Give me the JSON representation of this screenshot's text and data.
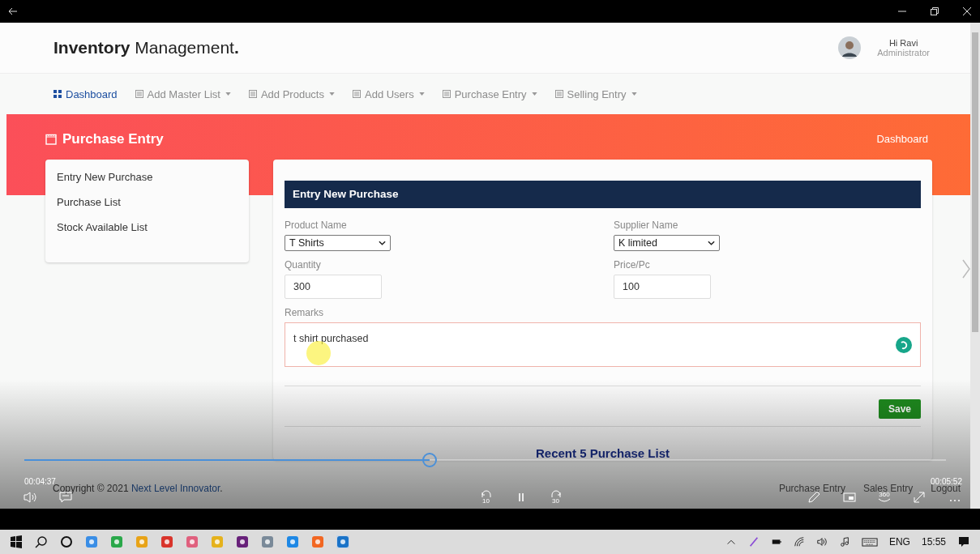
{
  "header": {
    "brand": "**Inventory** Management**.**",
    "user": {
      "greeting": "Hi Ravi",
      "role": "Administrator"
    }
  },
  "nav": [
    {
      "label": "Dashboard",
      "selected": true,
      "dropdown": false
    },
    {
      "label": "Add Master List",
      "selected": false,
      "dropdown": true
    },
    {
      "label": "Add Products",
      "selected": false,
      "dropdown": true
    },
    {
      "label": "Add Users",
      "selected": false,
      "dropdown": true
    },
    {
      "label": "Purchase Entry",
      "selected": false,
      "dropdown": true
    },
    {
      "label": "Selling Entry",
      "selected": false,
      "dropdown": true
    }
  ],
  "banner": {
    "title": "Purchase Entry",
    "link": "Dashboard"
  },
  "sidebar": {
    "items": [
      "Entry New Purchase",
      "Purchase List",
      "Stock Available List"
    ]
  },
  "form": {
    "title": "Entry New Purchase",
    "fields": [
      {
        "kind": "select",
        "label": "Product Name",
        "value": "T Shirts"
      },
      {
        "kind": "select",
        "label": "Supplier Name",
        "value": "K limited"
      },
      {
        "kind": "input",
        "label": "Quantity",
        "value": "300"
      },
      {
        "kind": "input",
        "label": "Price/Pc",
        "value": "100"
      }
    ],
    "remarks": {
      "label": "Remarks",
      "value": "t shirt purchased"
    },
    "save_button": "Save"
  },
  "recent_title": "Recent 5 Purchase List",
  "footer": {
    "copyright_prefix": "Copyright © 2021 ",
    "company": "Next Level Innovator",
    "copyright_suffix": ".",
    "links": [
      "Purchase Entry",
      "Sales Entry",
      "Logout"
    ]
  },
  "player": {
    "elapsed": "00:04:37",
    "duration": "00:05:52",
    "progress": {
      "level": 0.44
    },
    "rewind_label": "10",
    "forward_label": "30",
    "vr_label": "360"
  },
  "taskbar": {
    "language": "ENG",
    "time": "15:55"
  }
}
